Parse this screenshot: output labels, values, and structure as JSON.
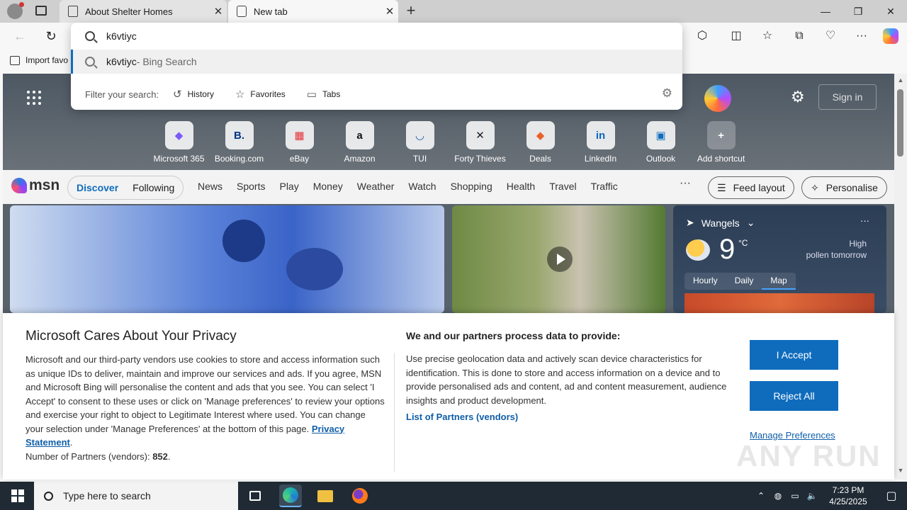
{
  "browser": {
    "tabs": [
      {
        "label": "About Shelter Homes",
        "active": false
      },
      {
        "label": "New tab",
        "active": true
      }
    ],
    "new_tab_symbol": "+",
    "window_controls": {
      "minimize": "—",
      "restore": "❐",
      "close": "✕"
    },
    "toolbar": {
      "back_icon": "←",
      "refresh_icon": "↻",
      "extensions_icon": "⬡",
      "split_icon": "◫",
      "favorites_icon": "☆",
      "collections_icon": "⧉",
      "performance_icon": "♡",
      "more_icon": "···"
    },
    "favbar": {
      "import_label": "Import favo"
    }
  },
  "omnibox": {
    "query": "k6vtiyc",
    "suggestion": {
      "text": "k6vtiyc",
      "suffix": " - Bing Search"
    },
    "filter_label": "Filter your search:",
    "filters": [
      {
        "label": "History",
        "icon": "↺"
      },
      {
        "label": "Favorites",
        "icon": "☆"
      },
      {
        "label": "Tabs",
        "icon": "▭"
      }
    ],
    "gear_icon": "⚙"
  },
  "ntp": {
    "sign_in": "Sign in",
    "gear_icon": "⚙",
    "shortcuts": [
      {
        "label": "Microsoft 365",
        "glyph": "◆",
        "color": "#7a5af5"
      },
      {
        "label": "Booking.com",
        "glyph": "B.",
        "color": "#003580"
      },
      {
        "label": "eBay",
        "glyph": "▦",
        "color": "#e53238"
      },
      {
        "label": "Amazon",
        "glyph": "a",
        "color": "#111111"
      },
      {
        "label": "TUI",
        "glyph": "◡",
        "color": "#1f5fa8"
      },
      {
        "label": "Forty Thieves",
        "glyph": "✕",
        "color": "#222222"
      },
      {
        "label": "Deals",
        "glyph": "◆",
        "color": "#e8622a"
      },
      {
        "label": "LinkedIn",
        "glyph": "in",
        "color": "#0a66c2"
      },
      {
        "label": "Outlook",
        "glyph": "▣",
        "color": "#0f6cbd"
      },
      {
        "label": "Add shortcut",
        "glyph": "+",
        "color": "#ffffff"
      }
    ]
  },
  "msn": {
    "logo": "msn",
    "segments": [
      "Discover",
      "Following"
    ],
    "categories": [
      "News",
      "Sports",
      "Play",
      "Money",
      "Weather",
      "Watch",
      "Shopping",
      "Health",
      "Travel",
      "Traffic"
    ],
    "more": "···",
    "feed_layout": "Feed layout",
    "personalise": "Personalise"
  },
  "weather": {
    "location": "Wangels",
    "temperature": "9",
    "unit": "°C",
    "pollen_level": "High",
    "pollen_when": "pollen tomorrow",
    "tabs": [
      "Hourly",
      "Daily",
      "Map"
    ],
    "active_tab": "Map"
  },
  "privacy": {
    "title": "Microsoft Cares About Your Privacy",
    "body": "Microsoft and our third-party vendors use cookies to store and access information such as unique IDs to deliver, maintain and improve our services and ads. If you agree, MSN and Microsoft Bing will personalise the content and ads that you see. You can select 'I Accept' to consent to these uses or click on 'Manage preferences' to review your options and exercise your right to object to Legitimate Interest where used.  You can change your selection under 'Manage Preferences' at the bottom of this page.",
    "privacy_link": "Privacy Statement",
    "partners_prefix": "Number of Partners (vendors):",
    "partners_count": "852",
    "process_title": "We and our partners process data to provide:",
    "process_body": "Use precise geolocation data and actively scan device characteristics for identification. This is done to store and access information on a device and to provide personalised ads and content, ad and content measurement, audience insights and product development.",
    "partners_link": "List of Partners (vendors)",
    "accept": "I Accept",
    "reject": "Reject All",
    "manage": "Manage Preferences"
  },
  "watermark": "ANY RUN",
  "taskbar": {
    "search_placeholder": "Type here to search",
    "time": "7:23 PM",
    "date": "4/25/2025"
  }
}
